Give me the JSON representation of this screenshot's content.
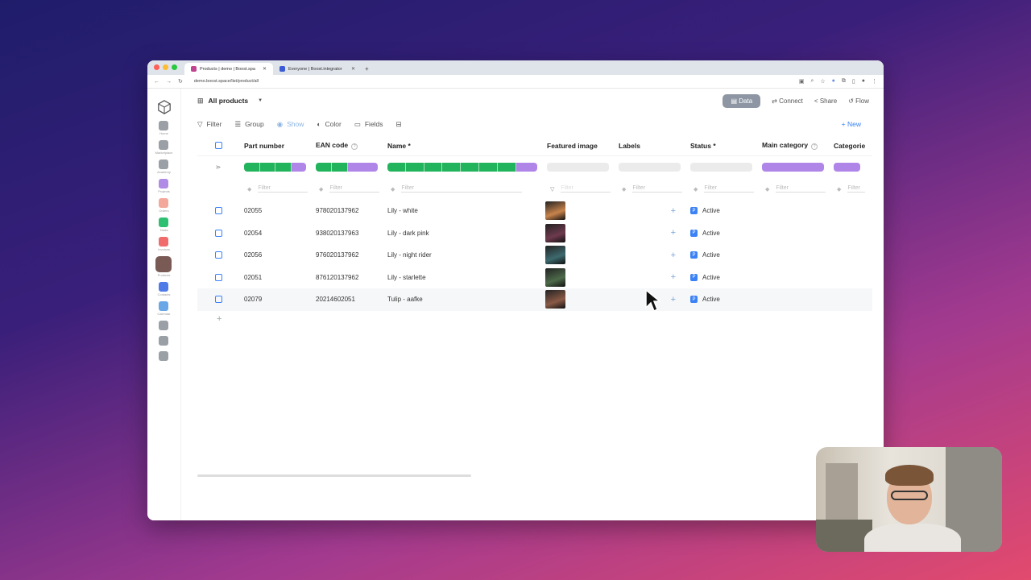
{
  "browser": {
    "tabs": [
      {
        "title": "Products | demo | Boost.spa",
        "active": true
      },
      {
        "title": "Everyone | Boost.integrator",
        "active": false
      }
    ],
    "url": "demo.boost.space/list/product/all"
  },
  "sidebar": {
    "items": [
      {
        "label": "Home",
        "color": "#9aa0a6"
      },
      {
        "label": "Marketplace",
        "color": "#9aa0a6"
      },
      {
        "label": "Academy",
        "color": "#9aa0a6"
      },
      {
        "label": "Projects",
        "color": "#b08be6"
      },
      {
        "label": "Orders",
        "color": "#f4a89b"
      },
      {
        "label": "Tasks",
        "color": "#2fbf71"
      },
      {
        "label": "Invoices",
        "color": "#f06b6b"
      },
      {
        "label": "Products",
        "color": "#7a5a55"
      },
      {
        "label": "Contacts",
        "color": "#4f7be8"
      },
      {
        "label": "Calendar",
        "color": "#6aa7e6"
      },
      {
        "label": "",
        "color": "#9aa0a6"
      },
      {
        "label": "",
        "color": "#9aa0a6"
      },
      {
        "label": "",
        "color": "#9aa0a6"
      }
    ]
  },
  "header": {
    "title": "All products",
    "data_label": "Data",
    "connect_label": "Connect",
    "share_label": "Share",
    "flow_label": "Flow"
  },
  "toolbar": {
    "filter": "Filter",
    "group": "Group",
    "show": "Show",
    "color": "Color",
    "fields": "Fields",
    "new": "+ New"
  },
  "table": {
    "columns": [
      "Part number",
      "EAN code",
      "Name *",
      "Featured image",
      "Labels",
      "Status *",
      "Main category",
      "Categories"
    ],
    "filter_placeholder": "Filter",
    "rows": [
      {
        "part": "02055",
        "ean": "978020137962",
        "name": "Lily - white",
        "img": "#c9844c",
        "status": "Active"
      },
      {
        "part": "02054",
        "ean": "938020137963",
        "name": "Lily - dark pink",
        "img": "#6e3a4e",
        "status": "Active"
      },
      {
        "part": "02056",
        "ean": "976020137962",
        "name": "Lily - night rider",
        "img": "#3d6a6e",
        "status": "Active"
      },
      {
        "part": "02051",
        "ean": "876120137962",
        "name": "Lily - starlette",
        "img": "#4d6a4a",
        "status": "Active"
      },
      {
        "part": "02079",
        "ean": "20214602051",
        "name": "Tulip - aafke",
        "img": "#8a5a46",
        "status": "Active"
      }
    ],
    "add_row": "+"
  },
  "colors": {
    "accent": "#3b82f6",
    "bar_green": "#22b45c",
    "bar_purple": "#b085e8"
  }
}
